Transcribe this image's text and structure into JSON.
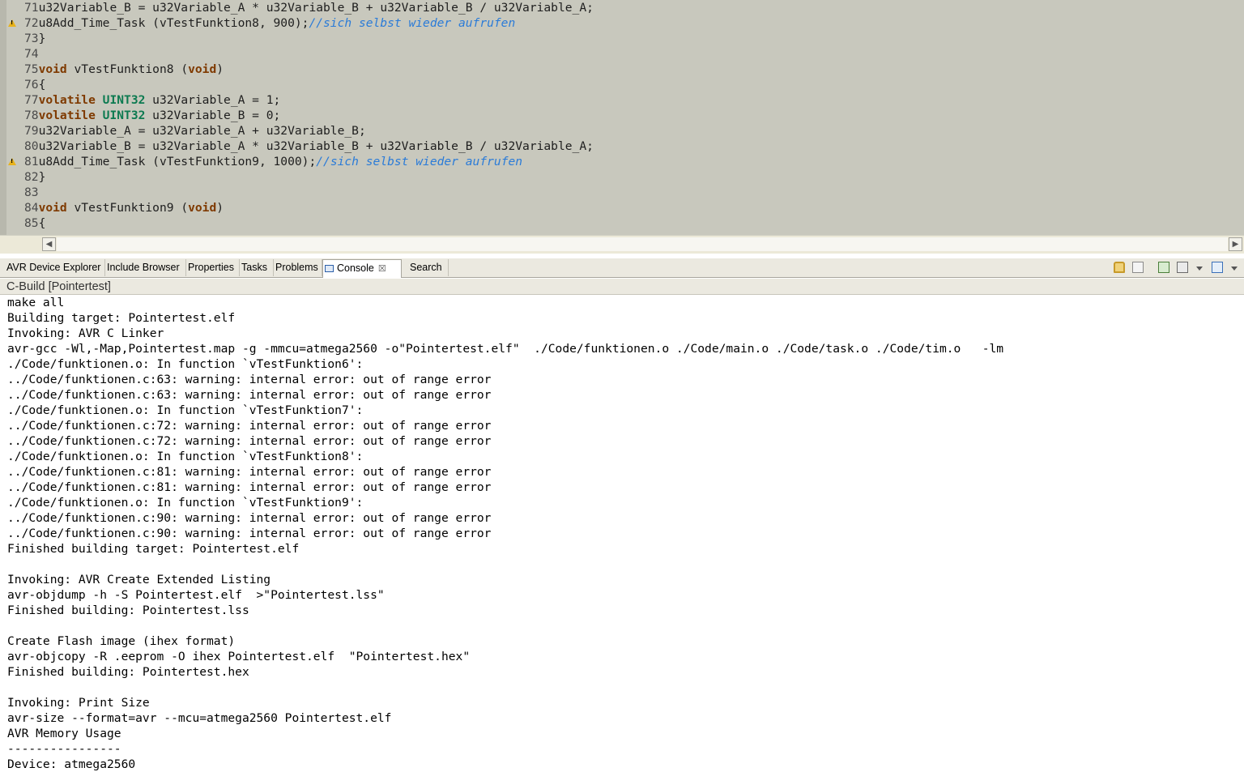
{
  "editor": {
    "lines": [
      {
        "num": "71",
        "warn": false,
        "tokens": [
          {
            "t": "txt",
            "v": "u32Variable_B = u32Variable_A * u32Variable_B + u32Variable_B / u32Variable_A;"
          }
        ]
      },
      {
        "num": "72",
        "warn": true,
        "tokens": [
          {
            "t": "txt",
            "v": "u8Add_Time_Task (vTestFunktion8, 900);"
          },
          {
            "t": "cm",
            "v": "//sich selbst wieder aufrufen"
          }
        ]
      },
      {
        "num": "73",
        "warn": false,
        "tokens": [
          {
            "t": "txt",
            "v": "}"
          }
        ]
      },
      {
        "num": "74",
        "warn": false,
        "tokens": []
      },
      {
        "num": "75",
        "warn": false,
        "tokens": [
          {
            "t": "kw",
            "v": "void"
          },
          {
            "t": "txt",
            "v": " vTestFunktion8 ("
          },
          {
            "t": "kw",
            "v": "void"
          },
          {
            "t": "txt",
            "v": ")"
          }
        ]
      },
      {
        "num": "76",
        "warn": false,
        "tokens": [
          {
            "t": "txt",
            "v": "{"
          }
        ]
      },
      {
        "num": "77",
        "warn": false,
        "tokens": [
          {
            "t": "kw",
            "v": "volatile"
          },
          {
            "t": "txt",
            "v": " "
          },
          {
            "t": "ty",
            "v": "UINT32"
          },
          {
            "t": "txt",
            "v": " u32Variable_A = 1;"
          }
        ]
      },
      {
        "num": "78",
        "warn": false,
        "tokens": [
          {
            "t": "kw",
            "v": "volatile"
          },
          {
            "t": "txt",
            "v": " "
          },
          {
            "t": "ty",
            "v": "UINT32"
          },
          {
            "t": "txt",
            "v": " u32Variable_B = 0;"
          }
        ]
      },
      {
        "num": "79",
        "warn": false,
        "tokens": [
          {
            "t": "txt",
            "v": "u32Variable_A = u32Variable_A + u32Variable_B;"
          }
        ]
      },
      {
        "num": "80",
        "warn": false,
        "tokens": [
          {
            "t": "txt",
            "v": "u32Variable_B = u32Variable_A * u32Variable_B + u32Variable_B / u32Variable_A;"
          }
        ]
      },
      {
        "num": "81",
        "warn": true,
        "tokens": [
          {
            "t": "txt",
            "v": "u8Add_Time_Task (vTestFunktion9, 1000);"
          },
          {
            "t": "cm",
            "v": "//sich selbst wieder aufrufen"
          }
        ]
      },
      {
        "num": "82",
        "warn": false,
        "tokens": [
          {
            "t": "txt",
            "v": "}"
          }
        ]
      },
      {
        "num": "83",
        "warn": false,
        "tokens": []
      },
      {
        "num": "84",
        "warn": false,
        "tokens": [
          {
            "t": "kw",
            "v": "void"
          },
          {
            "t": "txt",
            "v": " vTestFunktion9 ("
          },
          {
            "t": "kw",
            "v": "void"
          },
          {
            "t": "txt",
            "v": ")"
          }
        ]
      },
      {
        "num": "85",
        "warn": false,
        "tokens": [
          {
            "t": "txt",
            "v": "{"
          }
        ]
      }
    ],
    "colors": {
      "background": "#c8c8bd",
      "keyword": "#7f3a00",
      "type": "#0c7a50",
      "comment": "#2a7bd8"
    }
  },
  "scrollbar": {
    "left_arrow": "◀",
    "right_arrow": "▶"
  },
  "tabs": [
    {
      "label": "AVR Device Explorer",
      "active": false
    },
    {
      "label": "Include Browser",
      "active": false
    },
    {
      "label": "Properties",
      "active": false
    },
    {
      "label": "Tasks",
      "active": false
    },
    {
      "label": "Problems",
      "active": false
    },
    {
      "label": "Console",
      "active": true,
      "close": "☒"
    },
    {
      "label": "Search",
      "active": false
    }
  ],
  "toolbar_icons": [
    "lock-icon",
    "clear-console-icon",
    "pin-console-icon",
    "display-console-icon",
    "open-console-icon"
  ],
  "console": {
    "title": "C-Build [Pointertest]",
    "lines": [
      "make all",
      "Building target: Pointertest.elf",
      "Invoking: AVR C Linker",
      "avr-gcc -Wl,-Map,Pointertest.map -g -mmcu=atmega2560 -o\"Pointertest.elf\"  ./Code/funktionen.o ./Code/main.o ./Code/task.o ./Code/tim.o   -lm",
      "./Code/funktionen.o: In function `vTestFunktion6':",
      "../Code/funktionen.c:63: warning: internal error: out of range error",
      "../Code/funktionen.c:63: warning: internal error: out of range error",
      "./Code/funktionen.o: In function `vTestFunktion7':",
      "../Code/funktionen.c:72: warning: internal error: out of range error",
      "../Code/funktionen.c:72: warning: internal error: out of range error",
      "./Code/funktionen.o: In function `vTestFunktion8':",
      "../Code/funktionen.c:81: warning: internal error: out of range error",
      "../Code/funktionen.c:81: warning: internal error: out of range error",
      "./Code/funktionen.o: In function `vTestFunktion9':",
      "../Code/funktionen.c:90: warning: internal error: out of range error",
      "../Code/funktionen.c:90: warning: internal error: out of range error",
      "Finished building target: Pointertest.elf",
      "",
      "Invoking: AVR Create Extended Listing",
      "avr-objdump -h -S Pointertest.elf  >\"Pointertest.lss\"",
      "Finished building: Pointertest.lss",
      "",
      "Create Flash image (ihex format)",
      "avr-objcopy -R .eeprom -O ihex Pointertest.elf  \"Pointertest.hex\"",
      "Finished building: Pointertest.hex",
      "",
      "Invoking: Print Size",
      "avr-size --format=avr --mcu=atmega2560 Pointertest.elf",
      "AVR Memory Usage",
      "----------------",
      "Device: atmega2560"
    ]
  }
}
